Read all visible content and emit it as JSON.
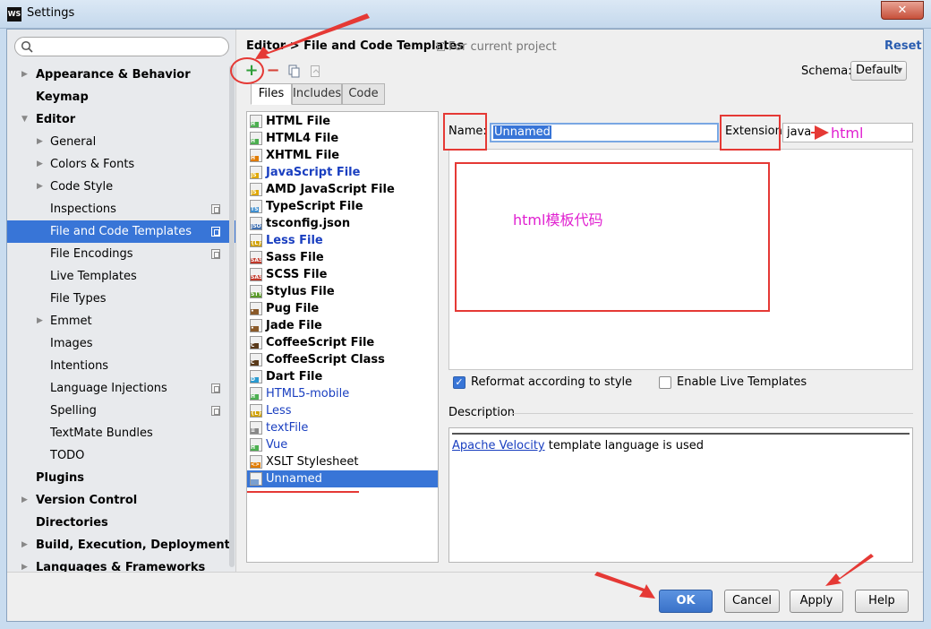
{
  "window": {
    "app_icon": "WS",
    "title": "Settings",
    "close_glyph": "✕"
  },
  "search": {
    "placeholder": ""
  },
  "tree": [
    {
      "label": "Appearance & Behavior",
      "bold": true,
      "arrow": "right",
      "indent": 0
    },
    {
      "label": "Keymap",
      "bold": true,
      "arrow": "",
      "indent": 0
    },
    {
      "label": "Editor",
      "bold": true,
      "arrow": "down",
      "indent": 0
    },
    {
      "label": "General",
      "arrow": "right",
      "indent": 1
    },
    {
      "label": "Colors & Fonts",
      "arrow": "right",
      "indent": 1
    },
    {
      "label": "Code Style",
      "arrow": "right",
      "indent": 1
    },
    {
      "label": "Inspections",
      "arrow": "",
      "indent": 1,
      "project": true
    },
    {
      "label": "File and Code Templates",
      "arrow": "",
      "indent": 1,
      "project": true,
      "selected": true
    },
    {
      "label": "File Encodings",
      "arrow": "",
      "indent": 1,
      "project": true
    },
    {
      "label": "Live Templates",
      "arrow": "",
      "indent": 1
    },
    {
      "label": "File Types",
      "arrow": "",
      "indent": 1
    },
    {
      "label": "Emmet",
      "arrow": "right",
      "indent": 1
    },
    {
      "label": "Images",
      "arrow": "",
      "indent": 1
    },
    {
      "label": "Intentions",
      "arrow": "",
      "indent": 1
    },
    {
      "label": "Language Injections",
      "arrow": "",
      "indent": 1,
      "project": true
    },
    {
      "label": "Spelling",
      "arrow": "",
      "indent": 1,
      "project": true
    },
    {
      "label": "TextMate Bundles",
      "arrow": "",
      "indent": 1
    },
    {
      "label": "TODO",
      "arrow": "",
      "indent": 1
    },
    {
      "label": "Plugins",
      "bold": true,
      "arrow": "",
      "indent": 0
    },
    {
      "label": "Version Control",
      "bold": true,
      "arrow": "right",
      "indent": 0
    },
    {
      "label": "Directories",
      "bold": true,
      "arrow": "",
      "indent": 0
    },
    {
      "label": "Build, Execution, Deployment",
      "bold": true,
      "arrow": "right",
      "indent": 0
    },
    {
      "label": "Languages & Frameworks",
      "bold": true,
      "arrow": "right",
      "indent": 0
    }
  ],
  "header": {
    "breadcrumb": "Editor > File and Code Templates",
    "scope_note": "For current project",
    "reset": "Reset",
    "schema_label": "Schema:",
    "schema_value": "Default"
  },
  "toolbar": {
    "add": "+",
    "remove": "−"
  },
  "tabs": [
    "Files",
    "Includes",
    "Code"
  ],
  "files": [
    {
      "name": "HTML File",
      "bold": true,
      "color": "#000000",
      "icon": "H",
      "icon_color": "#4caf50"
    },
    {
      "name": "HTML4 File",
      "bold": true,
      "color": "#000000",
      "icon": "H",
      "icon_color": "#4caf50"
    },
    {
      "name": "XHTML File",
      "bold": true,
      "color": "#000000",
      "icon": "H",
      "icon_color": "#e07b00"
    },
    {
      "name": "JavaScript File",
      "bold": true,
      "color": "#1a3fc0",
      "icon": "JS",
      "icon_color": "#e0a800"
    },
    {
      "name": "AMD JavaScript File",
      "bold": true,
      "color": "#000000",
      "icon": "JS",
      "icon_color": "#e0a800"
    },
    {
      "name": "TypeScript File",
      "bold": true,
      "color": "#000000",
      "icon": "TS",
      "icon_color": "#3f8fd0"
    },
    {
      "name": "tsconfig.json",
      "bold": true,
      "color": "#000000",
      "icon": "JSON",
      "icon_color": "#3f6fb0"
    },
    {
      "name": "Less File",
      "bold": true,
      "color": "#1a3fc0",
      "icon": "{L}",
      "icon_color": "#d0a000"
    },
    {
      "name": "Sass File",
      "bold": true,
      "color": "#000000",
      "icon": "SASS",
      "icon_color": "#c0392b"
    },
    {
      "name": "SCSS File",
      "bold": true,
      "color": "#000000",
      "icon": "SASS",
      "icon_color": "#c0392b"
    },
    {
      "name": "Stylus File",
      "bold": true,
      "color": "#000000",
      "icon": "STYL",
      "icon_color": "#5a9a2a"
    },
    {
      "name": "Pug File",
      "bold": true,
      "color": "#000000",
      "icon": "•",
      "icon_color": "#8a5a2a"
    },
    {
      "name": "Jade File",
      "bold": true,
      "color": "#000000",
      "icon": "•",
      "icon_color": "#8a5a2a"
    },
    {
      "name": "CoffeeScript File",
      "bold": true,
      "color": "#000000",
      "icon": "C",
      "icon_color": "#5a3a1a"
    },
    {
      "name": "CoffeeScript Class",
      "bold": true,
      "color": "#000000",
      "icon": "C",
      "icon_color": "#5a3a1a"
    },
    {
      "name": "Dart File",
      "bold": true,
      "color": "#000000",
      "icon": "D",
      "icon_color": "#2a9ad0"
    },
    {
      "name": "HTML5-mobile",
      "bold": false,
      "color": "#1a3fc0",
      "icon": "H",
      "icon_color": "#4caf50"
    },
    {
      "name": "Less",
      "bold": false,
      "color": "#1a3fc0",
      "icon": "{L}",
      "icon_color": "#d0a000"
    },
    {
      "name": "textFile",
      "bold": false,
      "color": "#1a3fc0",
      "icon": "≡",
      "icon_color": "#888888"
    },
    {
      "name": "Vue",
      "bold": false,
      "color": "#1a3fc0",
      "icon": "H",
      "icon_color": "#4caf50"
    },
    {
      "name": "XSLT Stylesheet",
      "bold": false,
      "color": "#000000",
      "icon": "<>",
      "icon_color": "#e07b00"
    },
    {
      "name": "Unnamed",
      "bold": false,
      "color": "#ffffff",
      "icon": "",
      "icon_color": "#7aa0d0",
      "selected": true
    }
  ],
  "form": {
    "name_label": "Name:",
    "name_value": "Unnamed",
    "extension_label": "Extension:",
    "extension_value": "java",
    "reformat_label": "Reformat according to style",
    "reformat_checked": true,
    "live_templates_label": "Enable Live Templates",
    "live_templates_checked": false,
    "description_label": "Description",
    "description_link": "Apache Velocity",
    "description_rest": " template language is used"
  },
  "buttons": {
    "ok": "OK",
    "cancel": "Cancel",
    "apply": "Apply",
    "help": "Help"
  },
  "annotations": {
    "extension_note": "html",
    "editor_note": "html模板代码",
    "color": "#e53935",
    "text_color": "#e020d0"
  },
  "colors": {
    "selection": "#3875d7",
    "link": "#2a5db0"
  }
}
